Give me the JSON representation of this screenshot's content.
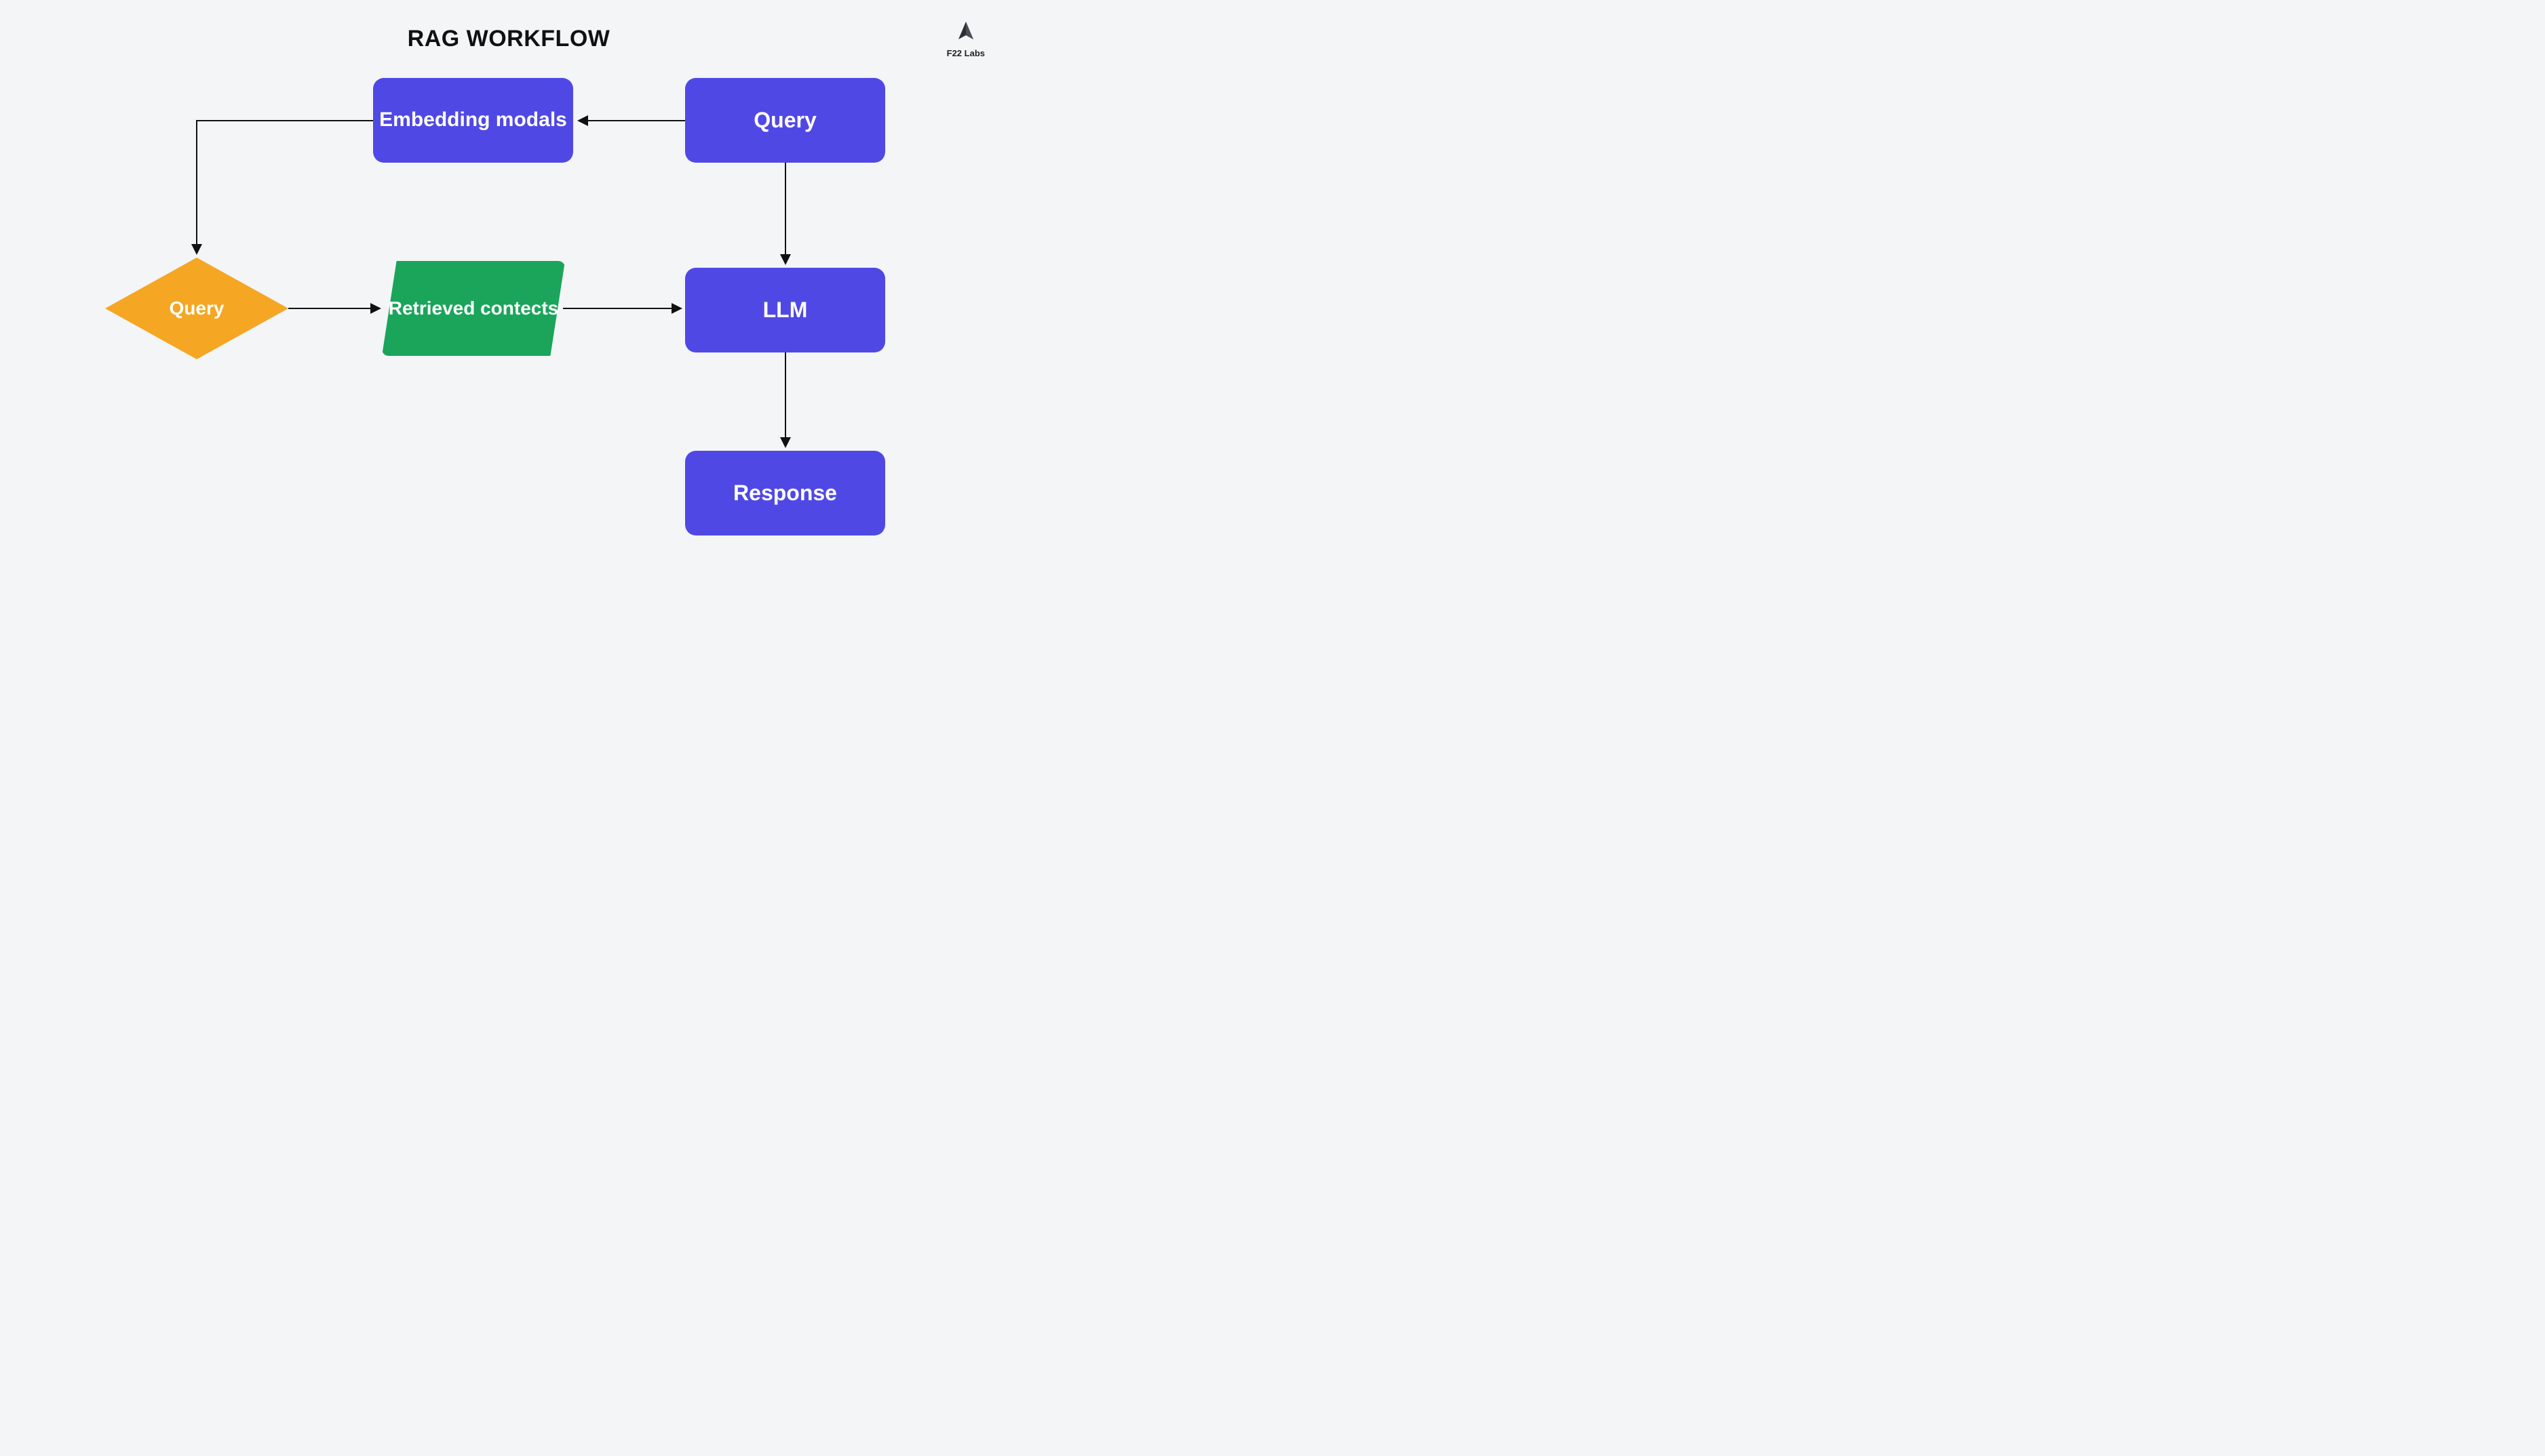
{
  "title": "RAG WORKFLOW",
  "brand": {
    "name": "F22 Labs"
  },
  "nodes": {
    "embedding": {
      "label": "Embedding modals"
    },
    "query_top": {
      "label": "Query"
    },
    "query_diamond": {
      "label": "Query"
    },
    "retrieved": {
      "label": "Retrieved contects"
    },
    "llm": {
      "label": "LLM"
    },
    "response": {
      "label": "Response"
    }
  },
  "colors": {
    "background": "#f3f5f7",
    "rect": "#5048e5",
    "diamond": "#f5a623",
    "parallelogram": "#1aa55a",
    "arrow": "#111111"
  },
  "flow": {
    "edges": [
      {
        "from": "query_top",
        "to": "embedding"
      },
      {
        "from": "embedding",
        "to": "query_diamond"
      },
      {
        "from": "query_diamond",
        "to": "retrieved"
      },
      {
        "from": "retrieved",
        "to": "llm"
      },
      {
        "from": "query_top",
        "to": "llm"
      },
      {
        "from": "llm",
        "to": "response"
      }
    ]
  }
}
